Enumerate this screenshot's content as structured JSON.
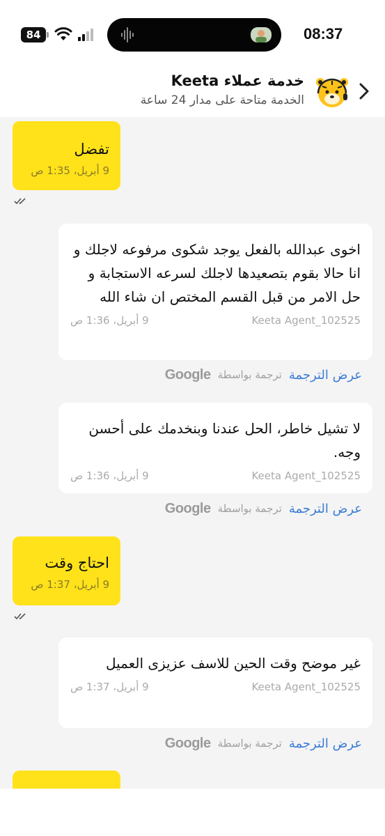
{
  "status_bar": {
    "battery": "84",
    "time": "08:37"
  },
  "header": {
    "title": "خدمة عملاء Keeta",
    "subtitle": "الخدمة متاحة على مدار 24 ساعة"
  },
  "messages": [
    {
      "type": "user",
      "text": "تفضل",
      "time": "9 أبريل، 1:35 ص"
    },
    {
      "type": "agent",
      "text": "اخوى عبدالله بالفعل يوجد شكوى مرفوعه لاجلك و انا حالا بقوم بتصعيدها لاجلك لسرعه الاستجابة و حل الامر من قبل القسم المختص ان شاء الله",
      "time": "9 أبريل، 1:36 ص",
      "sender": "Keeta Agent_102525"
    },
    {
      "type": "agent",
      "text": "لا تشيل خاطر، الحل عندنا وبنخدمك على أحسن وجه.",
      "time": "9 أبريل، 1:36 ص",
      "sender": "Keeta Agent_102525"
    },
    {
      "type": "user",
      "text": "احتاج وقت",
      "time": "9 أبريل، 1:37 ص"
    },
    {
      "type": "agent",
      "text": "غير موضح وقت الحين للاسف عزيزى العميل",
      "time": "9 أبريل، 1:37 ص",
      "sender": "Keeta Agent_102525"
    }
  ],
  "translation": {
    "show_label": "عرض الترجمة",
    "translated_by": "ترجمة بواسطة",
    "provider": "Google"
  },
  "colors": {
    "user_bubble": "#ffe21a",
    "agent_bubble": "#ffffff",
    "chat_background": "#f4f4f4",
    "link": "#3a7bd5"
  }
}
